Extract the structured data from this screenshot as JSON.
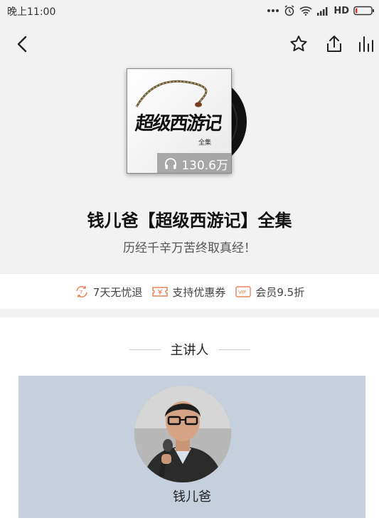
{
  "status_bar": {
    "time": "晚上11:00",
    "network_label": "HD",
    "icons": [
      "more-dots-icon",
      "alarm-icon",
      "wifi-icon",
      "signal-icon",
      "battery-icon"
    ]
  },
  "nav": {
    "icons": [
      "back-icon",
      "star-icon",
      "share-icon",
      "stats-icon"
    ]
  },
  "album": {
    "cover_title": "超级西游记",
    "cover_subtitle": "全集",
    "play_count": "130.6万"
  },
  "title": "钱儿爸【超级西游记】全集",
  "subtitle": "历经千辛万苦终取真经！",
  "benefits": [
    {
      "icon": "refund-icon",
      "label": "7天无忧退"
    },
    {
      "icon": "coupon-icon",
      "label": "支持优惠券"
    },
    {
      "icon": "vip-icon",
      "label": "会员9.5折"
    }
  ],
  "section": {
    "title": "主讲人"
  },
  "speaker": {
    "name": "钱儿爸"
  },
  "colors": {
    "background": "#f2f2f2",
    "accent": "#e8845a",
    "card": "#c6cfdc"
  }
}
